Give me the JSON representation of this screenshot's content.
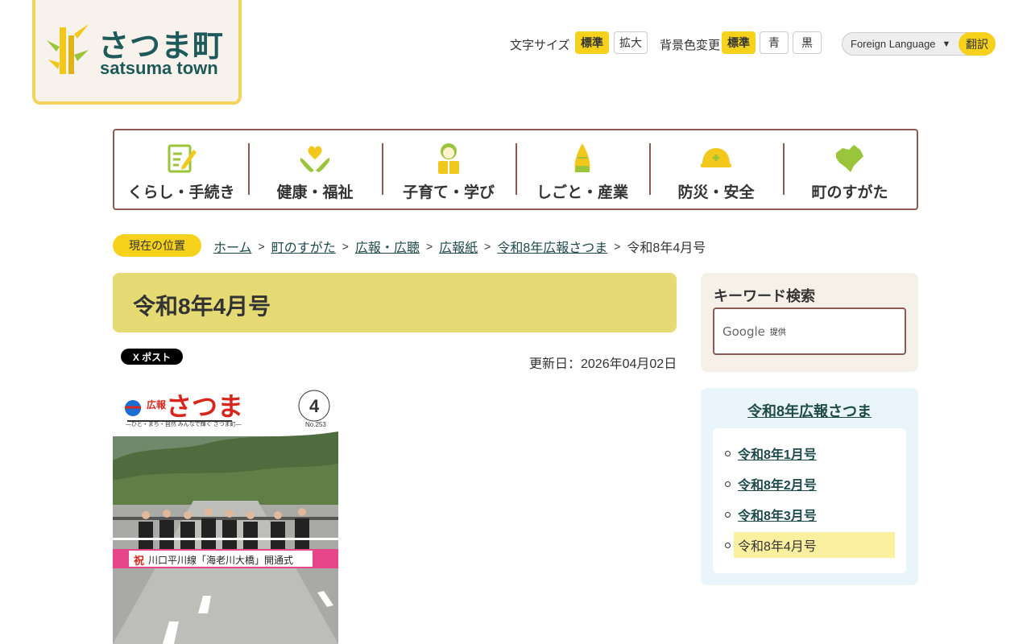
{
  "logo": {
    "name_jp": "さつま町",
    "name_en": "satsuma town"
  },
  "toolbar": {
    "text_size_label": "文字サイズ",
    "text_size_standard": "標準",
    "text_size_large": "拡大",
    "bg_label": "背景色変更",
    "bg_standard": "標準",
    "bg_blue": "青",
    "bg_black": "黒",
    "language_select": "Foreign Language",
    "translate_button": "翻訳"
  },
  "nav": {
    "items": [
      {
        "label": "くらし・手続き",
        "icon": "pencil-note-icon"
      },
      {
        "label": "健康・福祉",
        "icon": "heart-hands-icon"
      },
      {
        "label": "子育て・学び",
        "icon": "child-book-icon"
      },
      {
        "label": "しごと・産業",
        "icon": "bamboo-shoot-icon"
      },
      {
        "label": "防災・安全",
        "icon": "helmet-icon"
      },
      {
        "label": "町のすがた",
        "icon": "town-map-icon"
      }
    ]
  },
  "breadcrumb": {
    "badge": "現在の位置",
    "items": [
      "ホーム",
      "町のすがた",
      "広報・広聴",
      "広報紙",
      "令和8年広報さつま"
    ],
    "current": "令和8年4月号"
  },
  "content": {
    "title": "令和8年4月号",
    "x_post_label": "X ポスト",
    "updated": "更新日：2026年04月02日"
  },
  "cover": {
    "masthead_prefix": "広報",
    "masthead": "さつま",
    "tagline": "―ひと・まち・自然 みんなで輝く さつま町―",
    "month": "4",
    "issue_no": "No.253",
    "ribbon_mark": "祝",
    "ribbon_text": "川口平川線「海老川大橋」開通式"
  },
  "sidebar": {
    "search_title": "キーワード検索",
    "search_google": "Google",
    "search_by": "提供",
    "menu_title": "令和8年広報さつま",
    "menu_items": [
      "令和8年1月号",
      "令和8年2月号",
      "令和8年3月号"
    ],
    "menu_current": "令和8年4月号"
  },
  "colors": {
    "accent_yellow": "#f7d21c",
    "title_bg": "#e6da74",
    "nav_border": "#8b5a55",
    "link": "#1f4a4a"
  }
}
